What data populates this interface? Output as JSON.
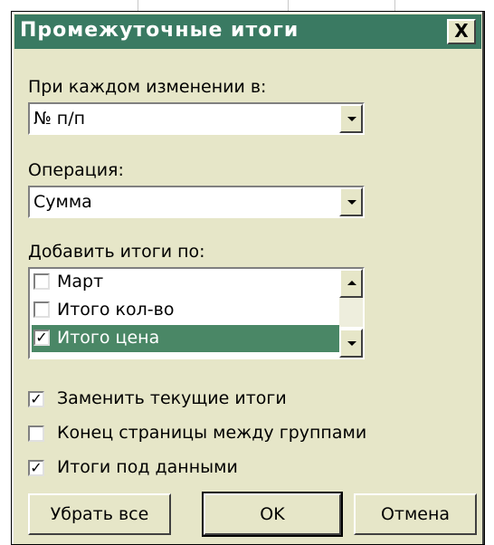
{
  "dialog": {
    "title": "Промежуточные итоги",
    "close_label": "X"
  },
  "group_by": {
    "label": "При каждом изменении в:",
    "value": "№ п/п"
  },
  "operation": {
    "label": "Операция:",
    "value": "Сумма"
  },
  "add_totals": {
    "label": "Добавить итоги по:",
    "items": [
      {
        "label": "Март",
        "checked": false,
        "selected": false
      },
      {
        "label": "Итого кол-во",
        "checked": false,
        "selected": false
      },
      {
        "label": "Итого цена",
        "checked": true,
        "selected": true
      }
    ]
  },
  "options": [
    {
      "label": "Заменить текущие итоги",
      "checked": true
    },
    {
      "label": "Конец страницы между группами",
      "checked": false
    },
    {
      "label": "Итоги под данными",
      "checked": true
    }
  ],
  "buttons": {
    "remove_all": "Убрать все",
    "ok": "OK",
    "cancel": "Отмена"
  },
  "colors": {
    "titlebar": "#3a7a62",
    "dialog_bg": "#e6e6c8",
    "selection": "#4a8766"
  },
  "icons": [
    "close-icon",
    "chevron-down-icon",
    "chevron-up-icon",
    "checkbox-icon"
  ]
}
